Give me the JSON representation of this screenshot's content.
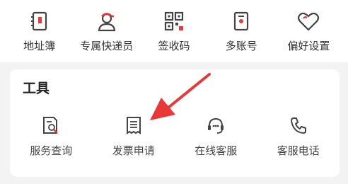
{
  "top_items": [
    {
      "label": "地址簿",
      "icon": "address-book-icon"
    },
    {
      "label": "专属快递员",
      "icon": "courier-icon"
    },
    {
      "label": "签收码",
      "icon": "qr-code-icon"
    },
    {
      "label": "多账号",
      "icon": "multi-account-icon"
    },
    {
      "label": "偏好设置",
      "icon": "heart-settings-icon"
    }
  ],
  "tools_section": {
    "title": "工具",
    "items": [
      {
        "label": "服务查询",
        "icon": "document-search-icon"
      },
      {
        "label": "发票申请",
        "icon": "invoice-icon"
      },
      {
        "label": "在线客服",
        "icon": "headset-icon"
      },
      {
        "label": "客服电话",
        "icon": "phone-icon"
      }
    ]
  },
  "colors": {
    "accent_red": "#e8393a",
    "icon_dark": "#444444",
    "background": "#f3f3f3"
  }
}
